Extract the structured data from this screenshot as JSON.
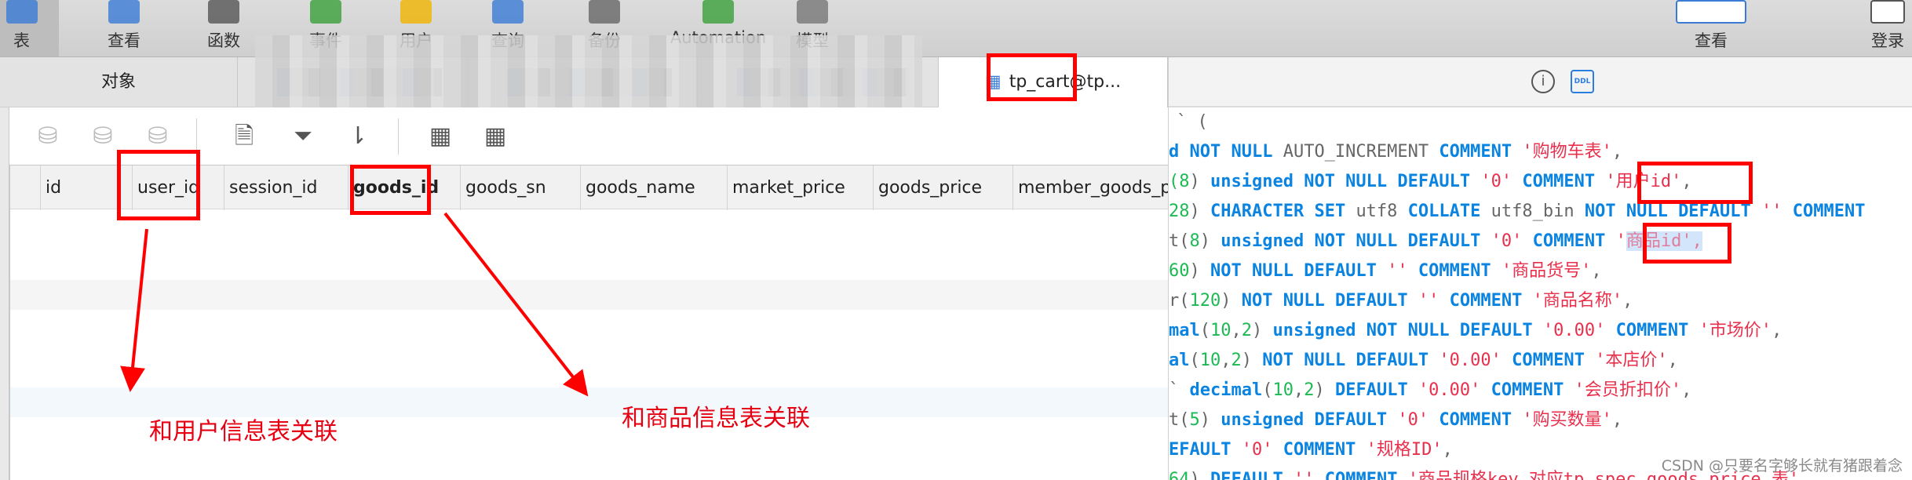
{
  "toolbar": {
    "items": [
      {
        "label": "表",
        "icon": "table-icon",
        "selected": true
      },
      {
        "label": "查看",
        "icon": "view-icon"
      },
      {
        "label": "函数",
        "icon": "function-icon"
      },
      {
        "label": "事件",
        "icon": "event-clock-icon"
      },
      {
        "label": "用户",
        "icon": "user-icon"
      },
      {
        "label": "查询",
        "icon": "query-icon"
      },
      {
        "label": "备份",
        "icon": "backup-icon"
      },
      {
        "label": "Automation",
        "icon": "automation-icon"
      },
      {
        "label": "模型",
        "icon": "model-icon"
      }
    ],
    "right_items": [
      {
        "label": "查看",
        "icon": "view-toggle-icon"
      },
      {
        "label": "登录",
        "icon": "login-icon"
      }
    ]
  },
  "tabs": {
    "objects": "对象",
    "active": "tp_cart@tp..."
  },
  "columns": [
    "id",
    "user_id",
    "session_id",
    "goods_id",
    "goods_sn",
    "goods_name",
    "market_price",
    "goods_price",
    "member_goods_price"
  ],
  "ddl_label": "DDL",
  "code_lines": [
    [
      [
        "p",
        "` ("
      ]
    ],
    [
      [
        "kw",
        "d NOT NULL "
      ],
      [
        "p",
        "AUTO_INCREMENT "
      ],
      [
        "kw",
        "COMMENT "
      ],
      [
        "str",
        "'购物车表'"
      ],
      [
        "p",
        ","
      ]
    ],
    [
      [
        "num",
        "(8"
      ],
      [
        "p",
        ") "
      ],
      [
        "kw",
        "unsigned NOT NULL DEFAULT "
      ],
      [
        "str",
        "'0' "
      ],
      [
        "kw",
        "COMMENT "
      ],
      [
        "str",
        "'用户id'"
      ],
      [
        "p",
        ","
      ]
    ],
    [
      [
        "num",
        "28"
      ],
      [
        "p",
        ") "
      ],
      [
        "kw",
        "CHARACTER SET "
      ],
      [
        "p",
        "utf8 "
      ],
      [
        "kw",
        "COLLATE "
      ],
      [
        "p",
        "utf8_bin "
      ],
      [
        "kw",
        "NOT NULL DEFAULT "
      ],
      [
        "str",
        "'' "
      ],
      [
        "kw",
        "COMMENT"
      ]
    ],
    [
      [
        "p",
        "t("
      ],
      [
        "num",
        "8"
      ],
      [
        "p",
        ") "
      ],
      [
        "kw",
        "unsigned NOT NULL DEFAULT "
      ],
      [
        "str",
        "'0' "
      ],
      [
        "kw",
        "COMMENT "
      ],
      [
        "str",
        "'"
      ],
      [
        "hl",
        "商品id',"
      ]
    ],
    [
      [
        "num",
        "60"
      ],
      [
        "p",
        ") "
      ],
      [
        "kw",
        "NOT NULL DEFAULT "
      ],
      [
        "str",
        "'' "
      ],
      [
        "kw",
        "COMMENT "
      ],
      [
        "str",
        "'商品货号'"
      ],
      [
        "p",
        ","
      ]
    ],
    [
      [
        "p",
        "r("
      ],
      [
        "num",
        "120"
      ],
      [
        "p",
        ") "
      ],
      [
        "kw",
        "NOT NULL DEFAULT "
      ],
      [
        "str",
        "'' "
      ],
      [
        "kw",
        "COMMENT "
      ],
      [
        "str",
        "'商品名称'"
      ],
      [
        "p",
        ","
      ]
    ],
    [
      [
        "kw",
        "mal"
      ],
      [
        "p",
        "("
      ],
      [
        "num",
        "10"
      ],
      [
        "p",
        ","
      ],
      [
        "num",
        "2"
      ],
      [
        "p",
        ") "
      ],
      [
        "kw",
        "unsigned NOT NULL DEFAULT "
      ],
      [
        "str",
        "'0.00' "
      ],
      [
        "kw",
        "COMMENT "
      ],
      [
        "str",
        "'市场价'"
      ],
      [
        "p",
        ","
      ]
    ],
    [
      [
        "kw",
        "al"
      ],
      [
        "p",
        "("
      ],
      [
        "num",
        "10"
      ],
      [
        "p",
        ","
      ],
      [
        "num",
        "2"
      ],
      [
        "p",
        ") "
      ],
      [
        "kw",
        "NOT NULL DEFAULT "
      ],
      [
        "str",
        "'0.00' "
      ],
      [
        "kw",
        "COMMENT "
      ],
      [
        "str",
        "'本店价'"
      ],
      [
        "p",
        ","
      ]
    ],
    [
      [
        "p",
        "` "
      ],
      [
        "kw",
        "decimal"
      ],
      [
        "p",
        "("
      ],
      [
        "num",
        "10"
      ],
      [
        "p",
        ","
      ],
      [
        "num",
        "2"
      ],
      [
        "p",
        ") "
      ],
      [
        "kw",
        "DEFAULT "
      ],
      [
        "str",
        "'0.00' "
      ],
      [
        "kw",
        "COMMENT "
      ],
      [
        "str",
        "'会员折扣价'"
      ],
      [
        "p",
        ","
      ]
    ],
    [
      [
        "p",
        "t("
      ],
      [
        "num",
        "5"
      ],
      [
        "p",
        ") "
      ],
      [
        "kw",
        "unsigned DEFAULT "
      ],
      [
        "str",
        "'0' "
      ],
      [
        "kw",
        "COMMENT "
      ],
      [
        "str",
        "'购买数量'"
      ],
      [
        "p",
        ","
      ]
    ],
    [
      [
        "kw",
        "EFAULT "
      ],
      [
        "str",
        "'0' "
      ],
      [
        "kw",
        "COMMENT "
      ],
      [
        "str",
        "'规格ID'"
      ],
      [
        "p",
        ","
      ]
    ],
    [
      [
        "num",
        "64"
      ],
      [
        "p",
        ") "
      ],
      [
        "kw",
        "DEFAULT "
      ],
      [
        "str",
        "'' "
      ],
      [
        "kw",
        "COMMENT "
      ],
      [
        "str",
        "'商品规格key 对应tp_spec_goods_price 表'"
      ]
    ]
  ],
  "annotations": {
    "user": "和用户信息表关联",
    "goods": "和商品信息表关联"
  },
  "watermark": "CSDN @只要名字够长就有猪跟着念",
  "colors": {
    "annotation": "#e60012",
    "keyword": "#0a84e0",
    "string": "#e8304d",
    "number": "#1db954"
  }
}
